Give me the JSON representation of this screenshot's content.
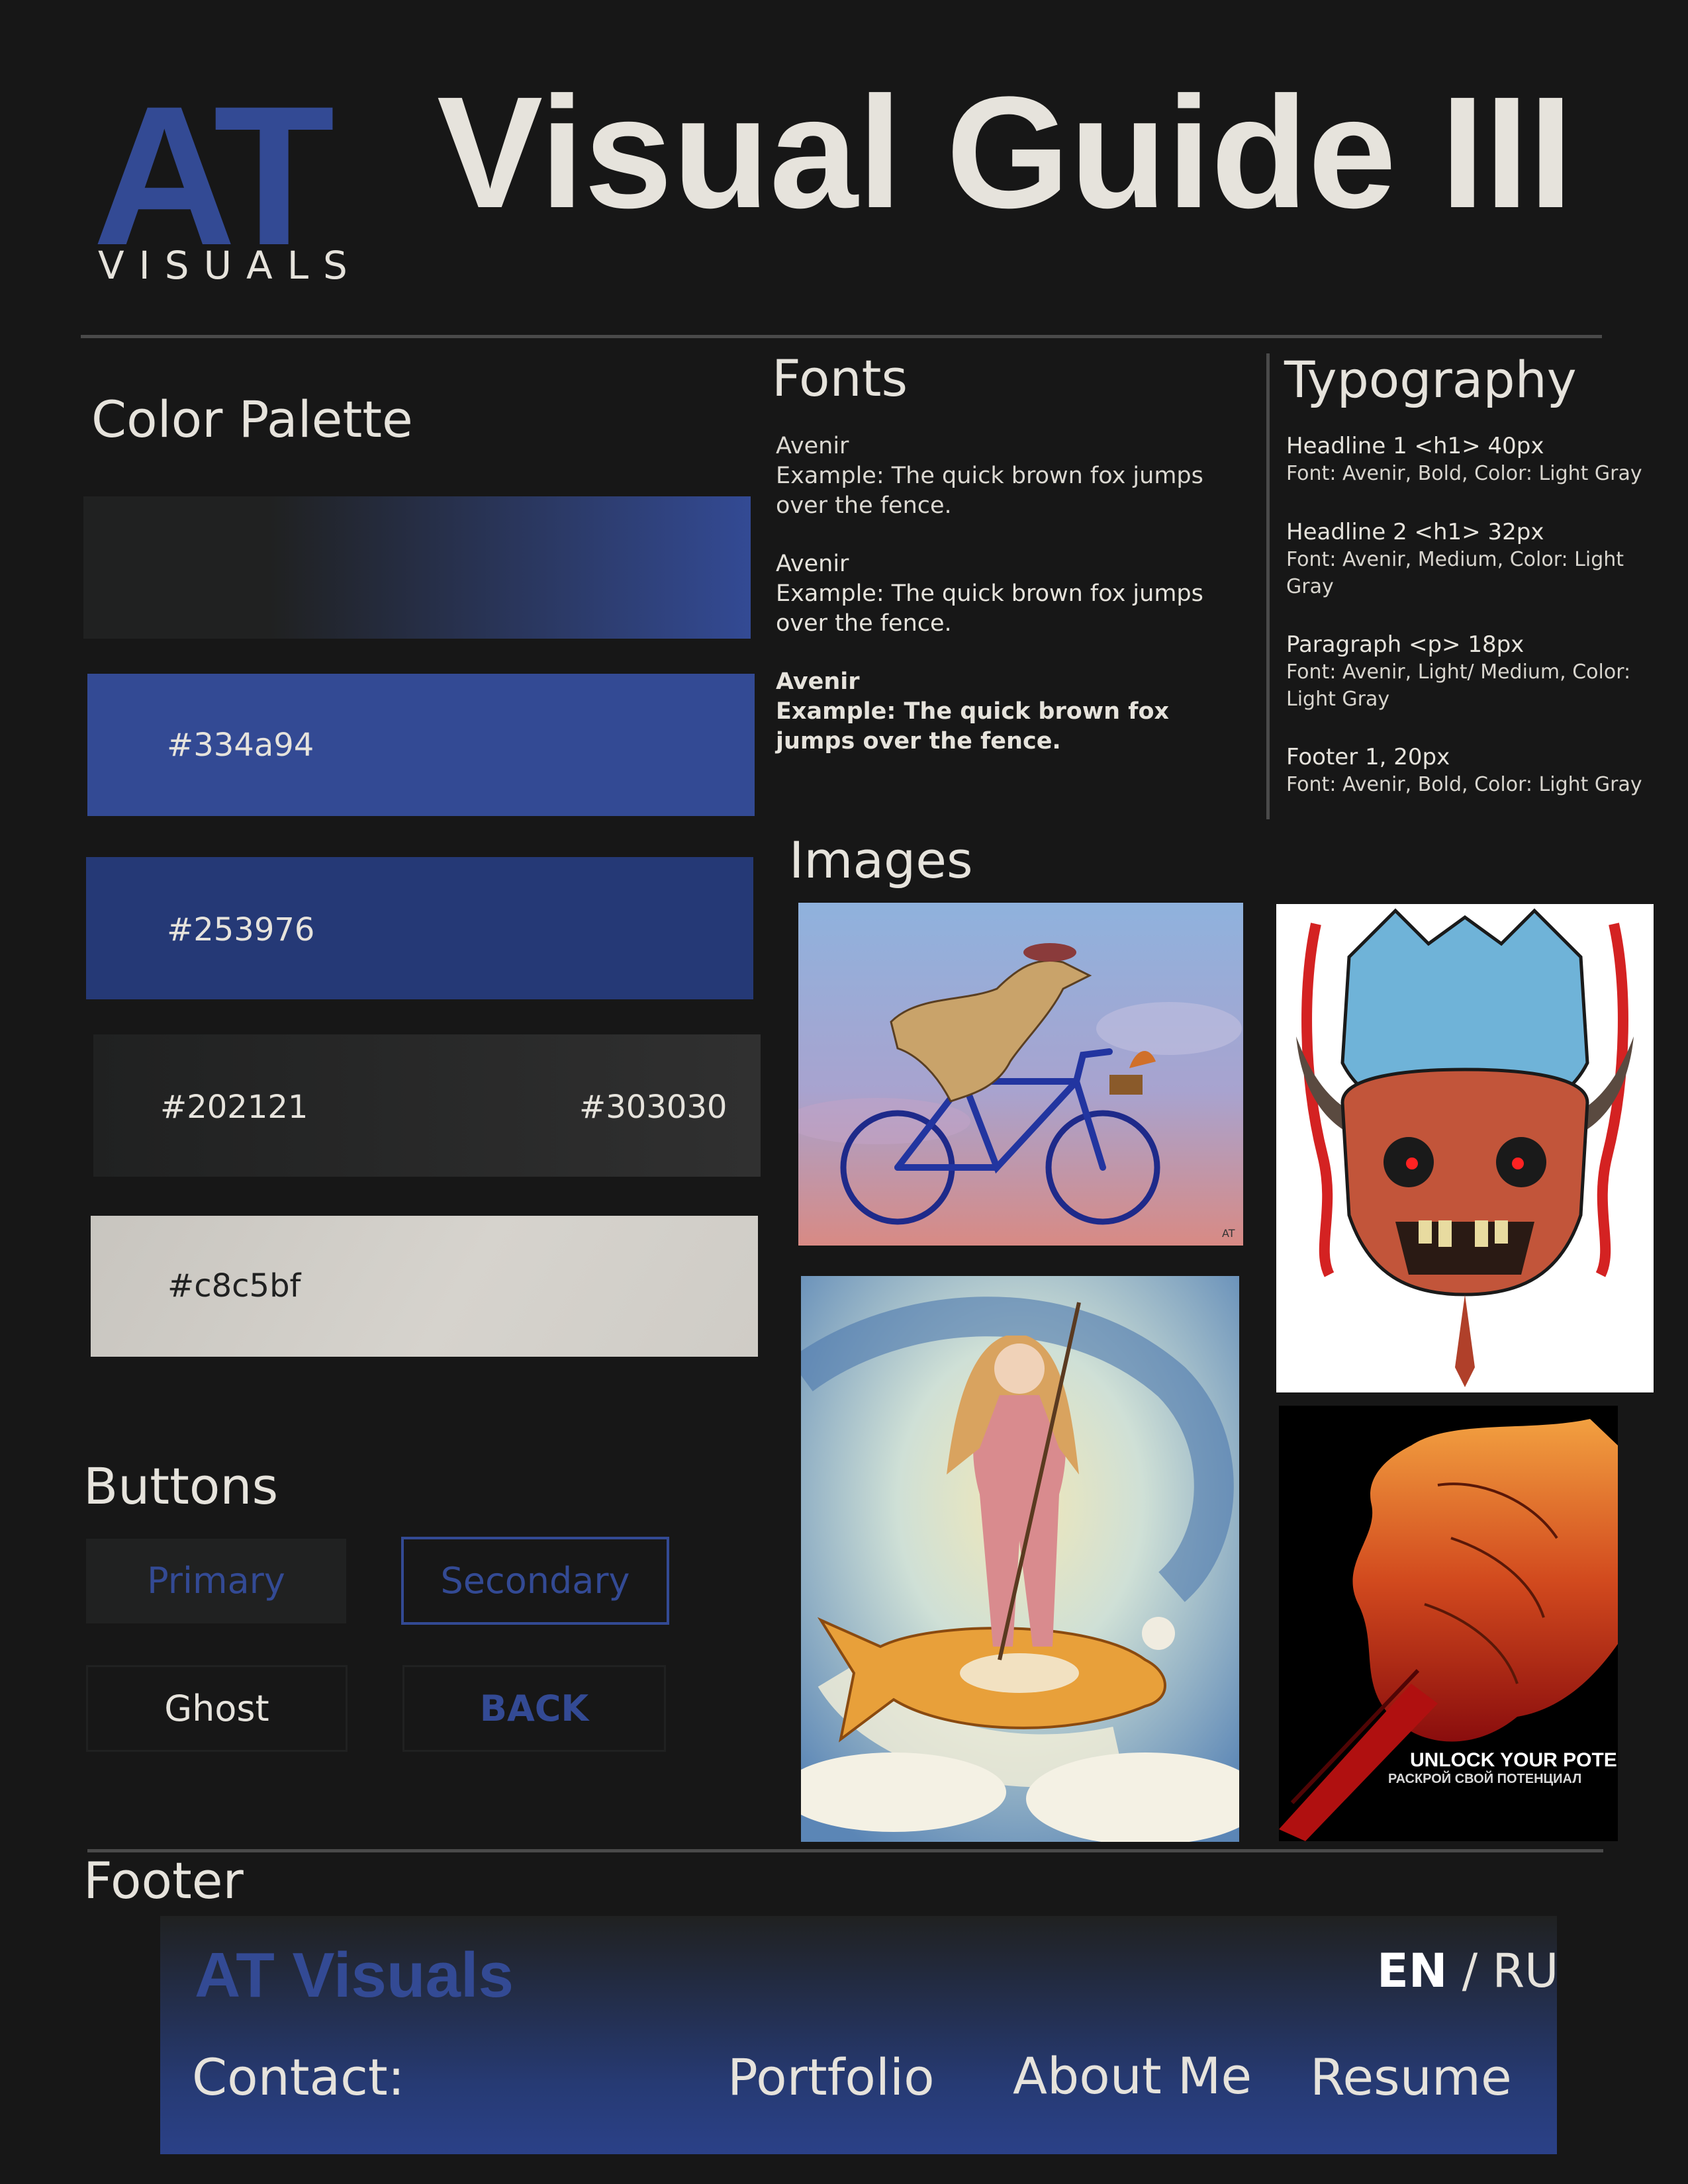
{
  "logo": {
    "mark": "AT",
    "wordmark": "VISUALS"
  },
  "title": "Visual Guide III",
  "color_palette": {
    "heading": "Color Palette",
    "swatches": [
      {
        "label": "",
        "colors": [
          "#202121",
          "#334a94"
        ]
      },
      {
        "label": "#334a94",
        "color": "#334a94"
      },
      {
        "label": "#253976",
        "color": "#253976"
      },
      {
        "label_left": "#202121",
        "label_right": "#303030",
        "colors": [
          "#202121",
          "#303030"
        ]
      },
      {
        "label": "#c8c5bf",
        "color": "#c8c5bf"
      }
    ]
  },
  "fonts": {
    "heading": "Fonts",
    "samples": [
      {
        "name": "Avenir",
        "example": "Example: The quick brown fox jumps over the fence.",
        "weight": "light"
      },
      {
        "name": "Avenir",
        "example": "Example: The quick brown fox jumps over the fence.",
        "weight": "medium"
      },
      {
        "name": "Avenir",
        "example": "Example: The quick brown fox jumps over the fence.",
        "weight": "bold"
      }
    ]
  },
  "typography": {
    "heading": "Typography",
    "items": [
      {
        "name": "Headline 1 <h1> 40px",
        "spec": "Font: Avenir, Bold, Color: Light Gray"
      },
      {
        "name": "Headline 2 <h1> 32px",
        "spec": "Font: Avenir, Medium, Color: Light Gray"
      },
      {
        "name": "Paragraph <p> 18px",
        "spec": "Font: Avenir, Light/ Medium, Color: Light Gray"
      },
      {
        "name": "Footer 1, 20px",
        "spec": "Font: Avenir, Bold, Color: Light Gray"
      }
    ]
  },
  "buttons": {
    "heading": "Buttons",
    "primary": "Primary",
    "secondary": "Secondary",
    "ghost": "Ghost",
    "back": "BACK"
  },
  "images": {
    "heading": "Images",
    "poster_title": "UNLOCK YOUR POTENTIAL",
    "poster_subtitle": "РАСКРОЙ СВОЙ ПОТЕНЦИАЛ",
    "signature": "AT"
  },
  "footer": {
    "heading": "Footer",
    "brand": "AT Visuals",
    "lang_active": "EN",
    "lang_separator": "/",
    "lang_other": "RU",
    "contact": "Contact:",
    "links": [
      "Portfolio",
      "About Me",
      "Resume"
    ]
  },
  "colors": {
    "background": "#171717",
    "primary_blue": "#334a94",
    "dark_blue": "#253976",
    "dark_gray": "#202121",
    "mid_gray": "#303030",
    "light_gray": "#c8c5bf",
    "text": "#e6e3dc"
  }
}
